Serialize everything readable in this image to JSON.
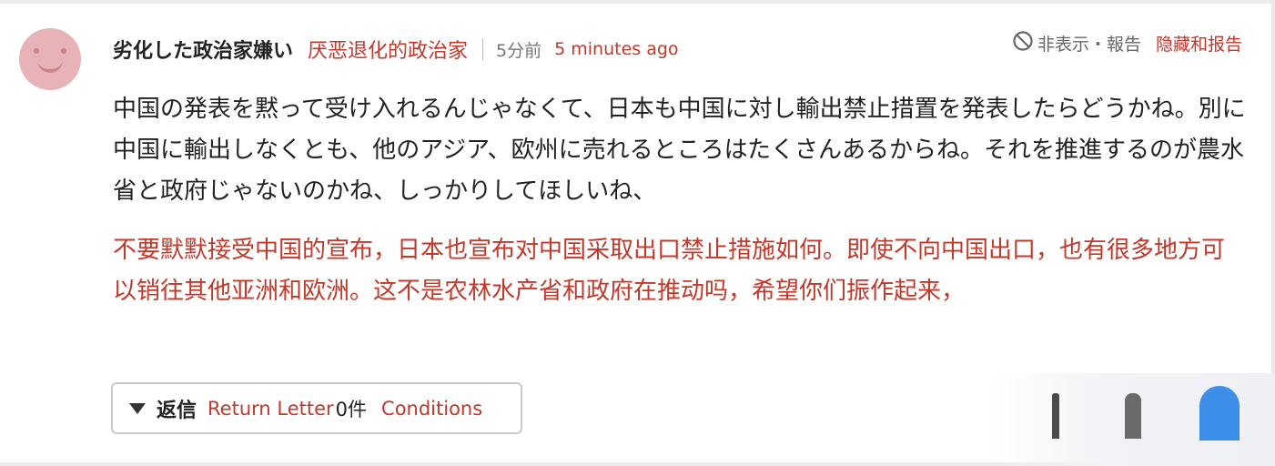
{
  "comment": {
    "author": "劣化した政治家嫌い",
    "author_translation": "厌恶退化的政治家",
    "time": "5分前",
    "time_translation": "5 minutes ago",
    "report_label": "非表示・報告",
    "report_translation": "隐藏和报告",
    "body_ja": "中国の発表を黙って受け入れるんじゃなくて、日本も中国に対し輸出禁止措置を発表したらどうかね。別に中国に輸出しなくとも、他のアジア、欧州に売れるところはたくさんあるからね。それを推進するのが農水省と政府じゃないのかね、しっかりしてほしいね、",
    "body_zh": "不要默默接受中国的宣布，日本也宣布对中国采取出口禁止措施如何。即使不向中国出口，也有很多地方可以销往其他亚洲和欧洲。这不是农林水产省和政府在推动吗，希望你们振作起来，",
    "reply": {
      "label": "返信",
      "label_translation": "Return Letter",
      "count": "0件",
      "count_translation": "Conditions"
    }
  },
  "icons": {
    "avatar": "smiley-avatar-icon",
    "report": "prohibit-icon",
    "reply_toggle": "triangle-down-icon"
  },
  "colors": {
    "translation_accent": "#c0392b",
    "avatar": "#e7b3b6",
    "avatar_features": "#c98287",
    "border": "#c9c9c9"
  }
}
